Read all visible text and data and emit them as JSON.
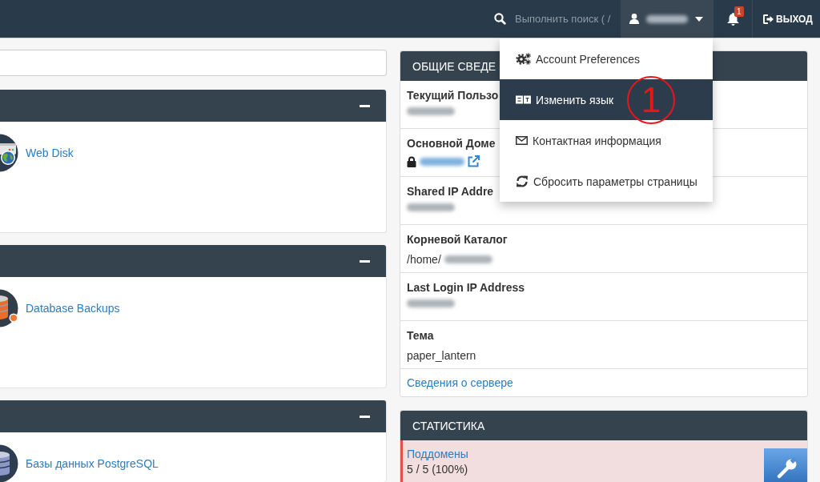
{
  "top_bar": {
    "search": {
      "placeholder": "Выполнить поиск ( /"
    },
    "user_menu": {
      "expanded": true,
      "items": [
        {
          "kind": "preferences",
          "label": "Account Preferences",
          "selected": false
        },
        {
          "kind": "language",
          "label": "Изменить язык",
          "selected": true
        },
        {
          "kind": "contact",
          "label": "Контактная информация",
          "selected": false
        },
        {
          "kind": "reset",
          "label": "Сбросить параметры страницы",
          "selected": false
        }
      ]
    },
    "notifications": {
      "count": "1"
    },
    "logout": {
      "label": "ВЫХОД"
    }
  },
  "callout": {
    "label": "1"
  },
  "left_panels": [
    {
      "expanded": true,
      "items": [
        {
          "kind": "webdisk",
          "label": "Web Disk"
        }
      ]
    },
    {
      "expanded": true,
      "items": [
        {
          "kind": "backups",
          "label": "Database Backups"
        }
      ]
    },
    {
      "expanded": true,
      "items": [
        {
          "kind": "postgres",
          "label": "Базы данных PostgreSQL"
        }
      ]
    }
  ],
  "info_panel": {
    "title": "ОБЩИЕ СВЕДЕ",
    "rows": [
      {
        "kind": "text",
        "label": "Текущий Пользо",
        "redacted": true
      },
      {
        "kind": "domain",
        "label": "Основной Доме",
        "redacted": true
      },
      {
        "kind": "text",
        "label": "Shared IP Addre",
        "redacted": true
      },
      {
        "kind": "text",
        "label": "Корневой Каталог",
        "value": "/home/",
        "redacted": true
      },
      {
        "kind": "text",
        "label": "Last Login IP Address",
        "redacted": true
      },
      {
        "kind": "text",
        "label": "Тема",
        "value": "paper_lantern",
        "redacted": false
      }
    ],
    "link": "Сведения о сервере"
  },
  "stats_panel": {
    "title": "СТАТИСТИКА",
    "rows": [
      {
        "label": "Поддомены",
        "value": "5 / 5 (100%)",
        "over_limit": true
      }
    ]
  }
}
